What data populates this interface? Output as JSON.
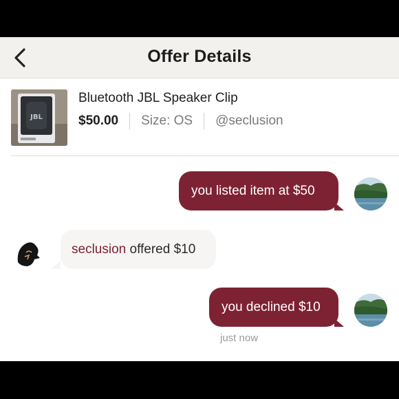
{
  "header": {
    "title": "Offer Details",
    "back_icon": "chevron-left-icon"
  },
  "item": {
    "title": "Bluetooth JBL Speaker Clip",
    "price": "$50.00",
    "size": "Size: OS",
    "seller": "@seclusion",
    "thumbnail": "speaker-product-image"
  },
  "messages": [
    {
      "from": "me",
      "text": "you listed item at $50"
    },
    {
      "from": "buyer",
      "user": "seclusion",
      "text": " offered $10"
    },
    {
      "from": "me",
      "text": "you declined $10",
      "time": "just now"
    }
  ],
  "colors": {
    "brand": "#7d2233",
    "header_bg": "#f2f1ee"
  }
}
